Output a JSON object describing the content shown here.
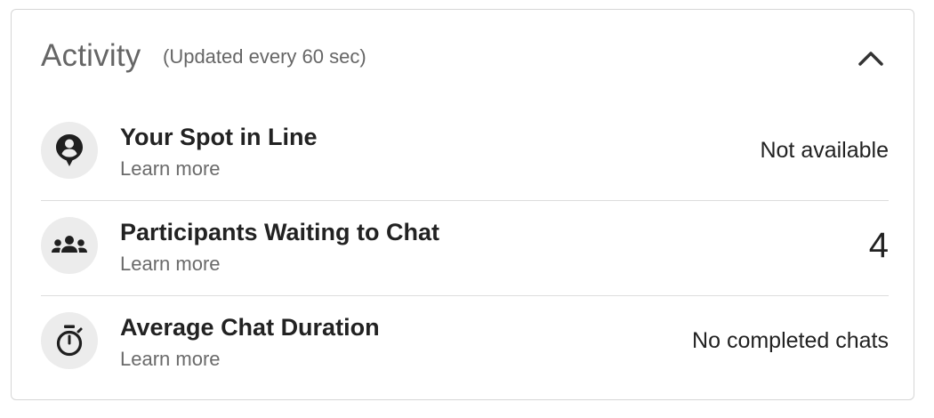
{
  "panel": {
    "title": "Activity",
    "subtitle": "(Updated every 60 sec)",
    "collapse_icon": "chevron-up-icon"
  },
  "rows": [
    {
      "icon": "person-pin-icon",
      "label": "Your Spot in Line",
      "link": "Learn more",
      "value": "Not available"
    },
    {
      "icon": "group-icon",
      "label": "Participants Waiting to Chat",
      "link": "Learn more",
      "value": "4"
    },
    {
      "icon": "stopwatch-icon",
      "label": "Average Chat Duration",
      "link": "Learn more",
      "value": "No completed chats"
    }
  ],
  "colors": {
    "border": "#d6d6d6",
    "icon_background": "#ececec",
    "muted_text": "#666666",
    "primary_text": "#222222"
  }
}
